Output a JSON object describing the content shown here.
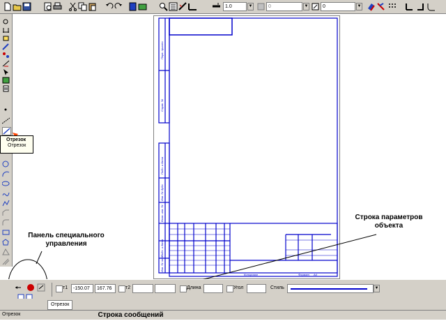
{
  "toolbar": {
    "line_weight": "1.0",
    "layer_value": "0",
    "style_value": "0"
  },
  "tooltip": {
    "title": "Отрезок",
    "line2": "Отрезок"
  },
  "properties": {
    "t1_label": "т1",
    "x1": "-150.07",
    "y1": "167.76",
    "t2_label": "т2",
    "length_label": "Длина",
    "angle_label": "Угол",
    "style_label": "Стиль"
  },
  "tab": {
    "label": "Отрезок"
  },
  "status": {
    "message": "Отрезок"
  },
  "annotations": {
    "params_row": "Строка параметров объекта",
    "special_panel": "Панель специального управления",
    "message_row": "Строка сообщений"
  },
  "stamp": {
    "vertical_labels": [
      "Перв. примен.",
      "Справ. №",
      "Подп. и дата",
      "Инв. № дубл.",
      "Взам. инв. №",
      "Подп. и дата",
      "Инв. № подл."
    ],
    "copied_label": "Копировал",
    "format_label": "Формат",
    "format_value": "A4"
  },
  "colors": {
    "frame": "#0000cc",
    "annotation_arrow": "#ff4400",
    "chrome": "#d4d0c8"
  }
}
